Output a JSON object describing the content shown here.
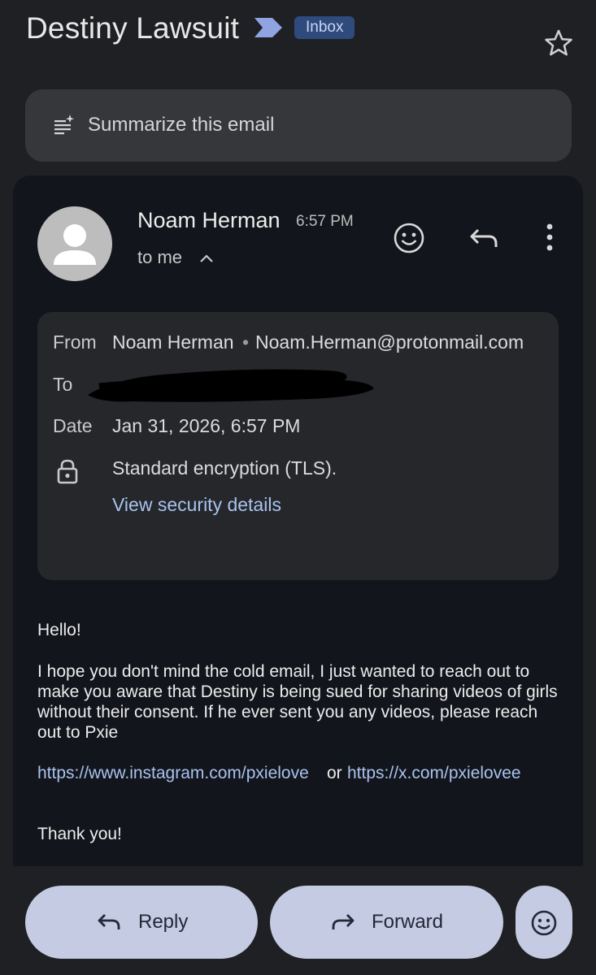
{
  "header": {
    "subject": "Destiny Lawsuit",
    "label": "Inbox",
    "star_icon": "star-outline-icon",
    "importance_icon": "importance-marker-icon"
  },
  "summarize": {
    "label": "Summarize this email",
    "icon": "sparkle-list-icon"
  },
  "message": {
    "sender_name": "Noam Herman",
    "time": "6:57 PM",
    "recipient_summary": "to me",
    "actions": [
      "emoji-reaction",
      "reply",
      "more-options"
    ]
  },
  "details": {
    "from_label": "From",
    "from_name": "Noam Herman",
    "separator": "•",
    "from_email": "Noam.Herman@protonmail.com",
    "to_label": "To",
    "date_label": "Date",
    "date_value": "Jan 31, 2026, 6:57 PM",
    "encryption": "Standard encryption (TLS).",
    "security_link": "View security details"
  },
  "body": {
    "greeting": "Hello!",
    "line1": "I hope you don't mind the cold email, I just wanted to reach out to",
    "line2": "make you aware that Destiny is being sued for sharing videos of girls",
    "line3": "without their consent. If he ever sent you any videos, please reach",
    "line4": "out to Pxie",
    "link1": "https://www.instagram.com/pxielove",
    "link_joiner": "or",
    "link2": "https://x.com/pxielovee",
    "signoff": "Thank you!"
  },
  "footer": {
    "reply_label": "Reply",
    "forward_label": "Forward"
  },
  "colors": {
    "background": "#1f2023",
    "card": "#13151c",
    "details_box": "#25272b",
    "link": "#a8c2ee",
    "button": "#c4cbe2",
    "label_badge": "#2f4a7c"
  }
}
